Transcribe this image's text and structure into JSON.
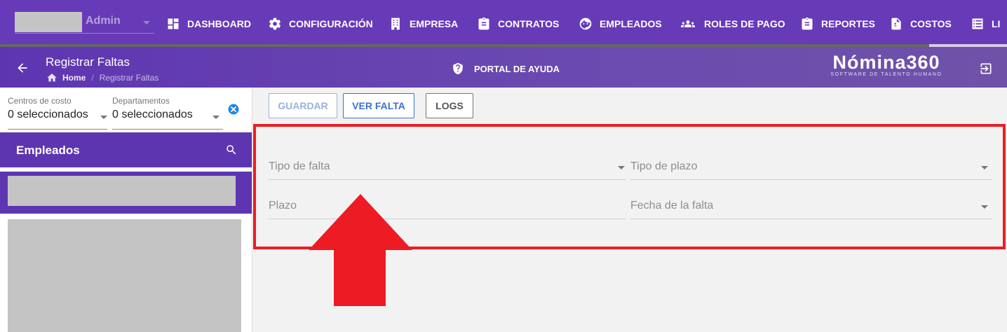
{
  "user": {
    "role": "Admin"
  },
  "nav": {
    "items": [
      {
        "label": "DASHBOARD",
        "icon": "dashboard-icon"
      },
      {
        "label": "CONFIGURACIÓN",
        "icon": "gear-icon"
      },
      {
        "label": "EMPRESA",
        "icon": "building-icon"
      },
      {
        "label": "CONTRATOS",
        "icon": "clipboard-icon"
      },
      {
        "label": "EMPLEADOS",
        "icon": "face-icon"
      },
      {
        "label": "ROLES DE PAGO",
        "icon": "group-icon"
      },
      {
        "label": "REPORTES",
        "icon": "clipboard-icon"
      },
      {
        "label": "COSTOS",
        "icon": "invoice-icon"
      },
      {
        "label": "LI",
        "icon": "list-icon"
      }
    ],
    "scroll_progress": 0.93
  },
  "header": {
    "title": "Registrar Faltas",
    "breadcrumb_home": "Home",
    "breadcrumb_current": "Registrar Faltas",
    "help_label": "PORTAL DE AYUDA",
    "brand_name": "Nómina360",
    "brand_tagline": "SOFTWARE DE TALENTO HUMANO"
  },
  "filters": {
    "cost_centers": {
      "label": "Centros de costo",
      "value": "0 seleccionados"
    },
    "departments": {
      "label": "Departamentos",
      "value": "0 seleccionados"
    }
  },
  "employees": {
    "title": "Empleados"
  },
  "toolbar": {
    "save_label": "GUARDAR",
    "view_label": "VER FALTA",
    "logs_label": "LOGS"
  },
  "form": {
    "absence_type": "Tipo de falta",
    "term_type": "Tipo de plazo",
    "term": "Plazo",
    "absence_date": "Fecha de la falta"
  },
  "colors": {
    "primary": "#673ab7",
    "highlight": "#ed1c24",
    "view_button": "#3b6fd1"
  }
}
